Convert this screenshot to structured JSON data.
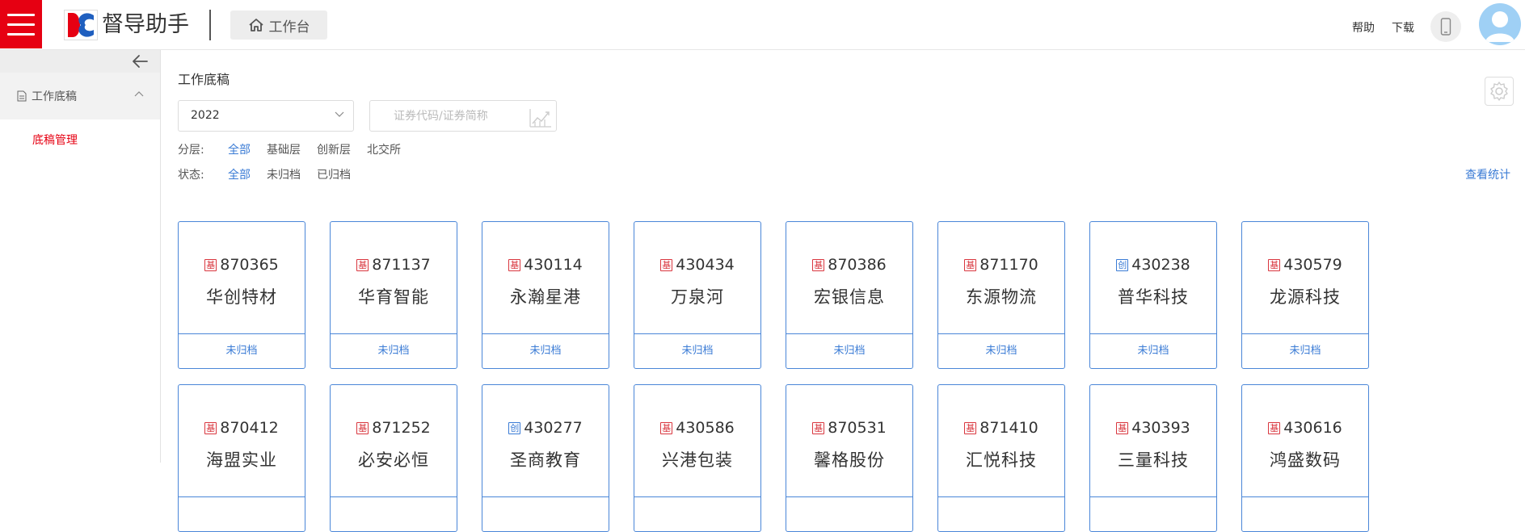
{
  "header": {
    "app_title": "督导助手",
    "workbench_label": "工作台",
    "help_label": "帮助",
    "download_label": "下载"
  },
  "sidebar": {
    "group_label": "工作底稿",
    "items": [
      {
        "label": "底稿管理"
      }
    ]
  },
  "main": {
    "page_title": "工作底稿",
    "year_select": "2022",
    "code_input_placeholder": "证券代码/证券简称",
    "layer_label": "分层:",
    "layer_options": [
      "全部",
      "基础层",
      "创新层",
      "北交所"
    ],
    "status_label": "状态:",
    "status_options": [
      "全部",
      "未归档",
      "已归档"
    ],
    "stats_link": "查看统计"
  },
  "cards": [
    {
      "tier": "基",
      "code": "870365",
      "name": "华创特材",
      "status": "未归档"
    },
    {
      "tier": "基",
      "code": "871137",
      "name": "华育智能",
      "status": "未归档"
    },
    {
      "tier": "基",
      "code": "430114",
      "name": "永瀚星港",
      "status": "未归档"
    },
    {
      "tier": "基",
      "code": "430434",
      "name": "万泉河",
      "status": "未归档"
    },
    {
      "tier": "基",
      "code": "870386",
      "name": "宏银信息",
      "status": "未归档"
    },
    {
      "tier": "基",
      "code": "871170",
      "name": "东源物流",
      "status": "未归档"
    },
    {
      "tier": "创",
      "code": "430238",
      "name": "普华科技",
      "status": "未归档"
    },
    {
      "tier": "基",
      "code": "430579",
      "name": "龙源科技",
      "status": "未归档"
    },
    {
      "tier": "基",
      "code": "870412",
      "name": "海盟实业",
      "status": ""
    },
    {
      "tier": "基",
      "code": "871252",
      "name": "必安必恒",
      "status": ""
    },
    {
      "tier": "创",
      "code": "430277",
      "name": "圣商教育",
      "status": ""
    },
    {
      "tier": "基",
      "code": "430586",
      "name": "兴港包装",
      "status": ""
    },
    {
      "tier": "基",
      "code": "870531",
      "name": "馨格股份",
      "status": ""
    },
    {
      "tier": "基",
      "code": "871410",
      "name": "汇悦科技",
      "status": ""
    },
    {
      "tier": "基",
      "code": "430393",
      "name": "三量科技",
      "status": ""
    },
    {
      "tier": "基",
      "code": "430616",
      "name": "鸿盛数码",
      "status": ""
    }
  ],
  "colors": {
    "brand_red": "#e60012",
    "link_blue": "#3a7bd5",
    "card_border": "#4a86d8"
  }
}
